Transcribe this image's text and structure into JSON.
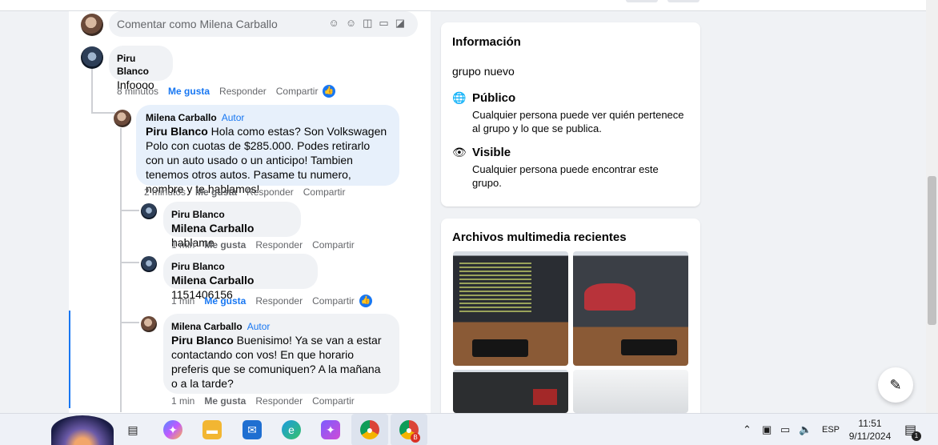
{
  "comment_box": {
    "placeholder": "Comentar como Milena Carballo",
    "icons": [
      "avatar-sticker-icon",
      "emoji-icon",
      "camera-icon",
      "gif-icon",
      "sticker-icon"
    ]
  },
  "comments": [
    {
      "author": "Piru Blanco",
      "text": "Infoooo",
      "time": "8 minutos",
      "like": "Me gusta",
      "reply": "Responder",
      "share": "Compartir"
    },
    {
      "author": "Milena Carballo",
      "tag": "Autor",
      "mention": "Piru Blanco",
      "text": " Hola como estas? Son Volkswagen Polo con cuotas de $285.000. Podes retirarlo con un auto usado o un anticipo! Tambien tenemos otros autos. Pasame tu numero, nombre y te hablamos!",
      "time": "2 minutos",
      "like": "Me gusta",
      "reply": "Responder",
      "share": "Compartir"
    },
    {
      "author": "Piru Blanco",
      "mention": "Milena Carballo",
      "text": " hablame",
      "time": "1 min",
      "like": "Me gusta",
      "reply": "Responder",
      "share": "Compartir"
    },
    {
      "author": "Piru Blanco",
      "mention": "Milena Carballo",
      "text": " 1151406156",
      "time": "1 min",
      "like": "Me gusta",
      "reply": "Responder",
      "share": "Compartir"
    },
    {
      "author": "Milena Carballo",
      "tag": "Autor",
      "mention": "Piru Blanco",
      "text": " Buenisimo! Ya se van a estar contactando con vos! En que horario preferis que se comuniquen? A la mañana o a la tarde?",
      "time": "1 min",
      "like": "Me gusta",
      "reply": "Responder",
      "share": "Compartir"
    }
  ],
  "info_card": {
    "title": "Información",
    "description": "grupo nuevo",
    "public_title": "Público",
    "public_text": "Cualquier persona puede ver quién pertenece al grupo y lo que se publica.",
    "visible_title": "Visible",
    "visible_text": "Cualquier persona puede encontrar este grupo."
  },
  "media_card": {
    "title": "Archivos multimedia recientes"
  },
  "taskbar": {
    "language": "ESP",
    "time": "11:51",
    "date": "9/11/2024",
    "notifications": "1",
    "chrome_badge": "B"
  },
  "colors": {
    "accent": "#1877f2",
    "bubble_grey": "#f0f2f5",
    "bubble_blue": "#e7f0fb",
    "meta": "#65676b"
  }
}
